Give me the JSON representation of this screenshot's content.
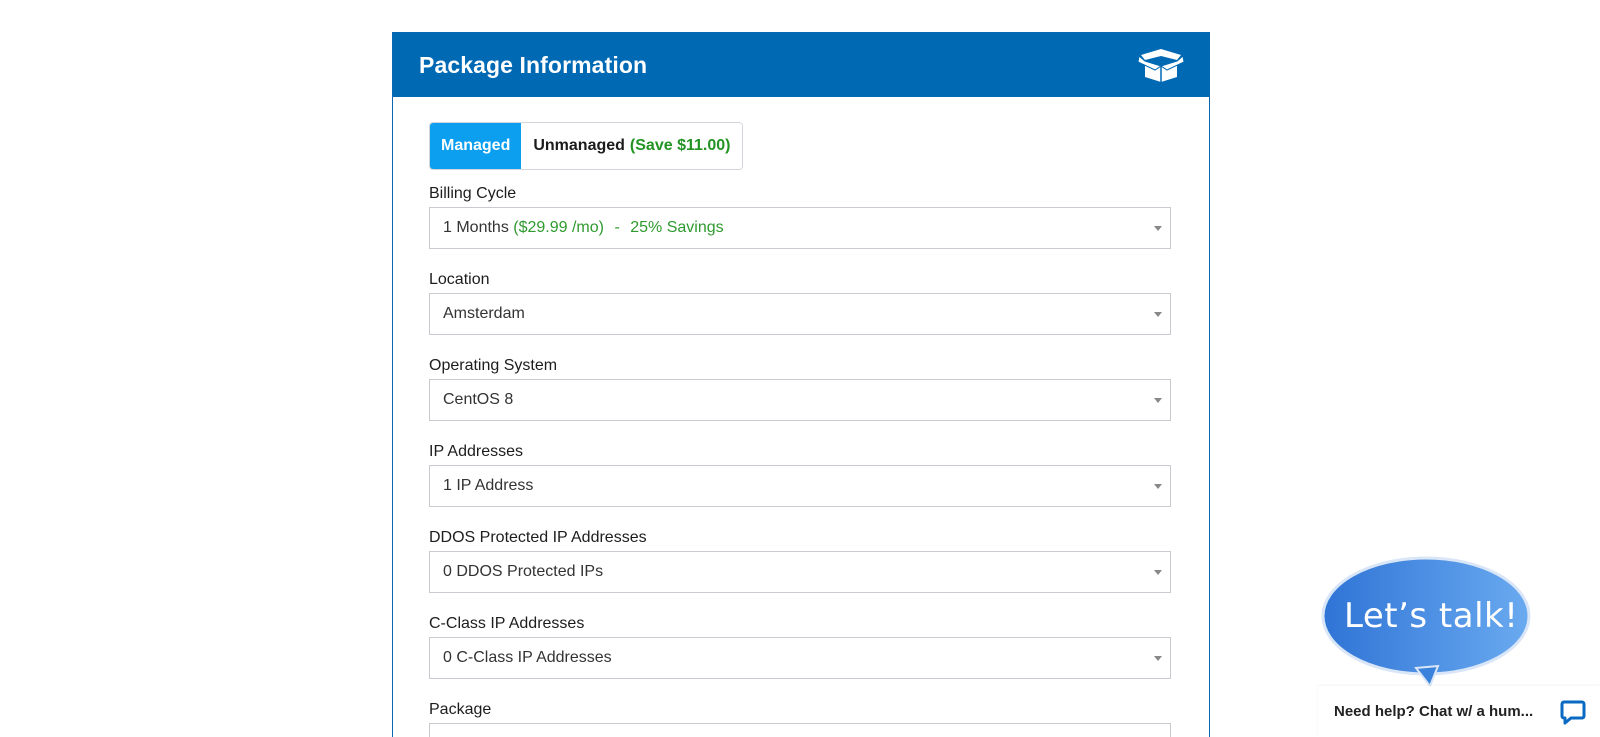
{
  "panel": {
    "title": "Package Information",
    "icon": "open-box-icon"
  },
  "management": {
    "options": [
      {
        "label": "Managed",
        "active": true
      },
      {
        "label": "Unmanaged",
        "save_note": "(Save $11.00)",
        "active": false
      }
    ]
  },
  "fields": {
    "billing_cycle": {
      "label": "Billing Cycle",
      "value_main": "1 Months",
      "value_price": "($29.99 /mo)",
      "value_sep": "-",
      "value_savings": "25% Savings"
    },
    "location": {
      "label": "Location",
      "value": "Amsterdam"
    },
    "operating_system": {
      "label": "Operating System",
      "value": "CentOS 8"
    },
    "ip_addresses": {
      "label": "IP Addresses",
      "value": "1 IP Address"
    },
    "ddos_ips": {
      "label": "DDOS Protected IP Addresses",
      "value": "0 DDOS Protected IPs"
    },
    "cclass_ips": {
      "label": "C-Class IP Addresses",
      "value": "0 C-Class IP Addresses"
    },
    "package": {
      "label": "Package"
    }
  },
  "chat": {
    "bubble_text": "Let’s talk!",
    "bar_text": "Need help? Chat w/ a hum...",
    "icon": "chat-bubble-icon"
  },
  "colors": {
    "header_blue": "#0069b4",
    "active_toggle": "#0c9ff0",
    "savings_green": "#2f9a2f"
  }
}
